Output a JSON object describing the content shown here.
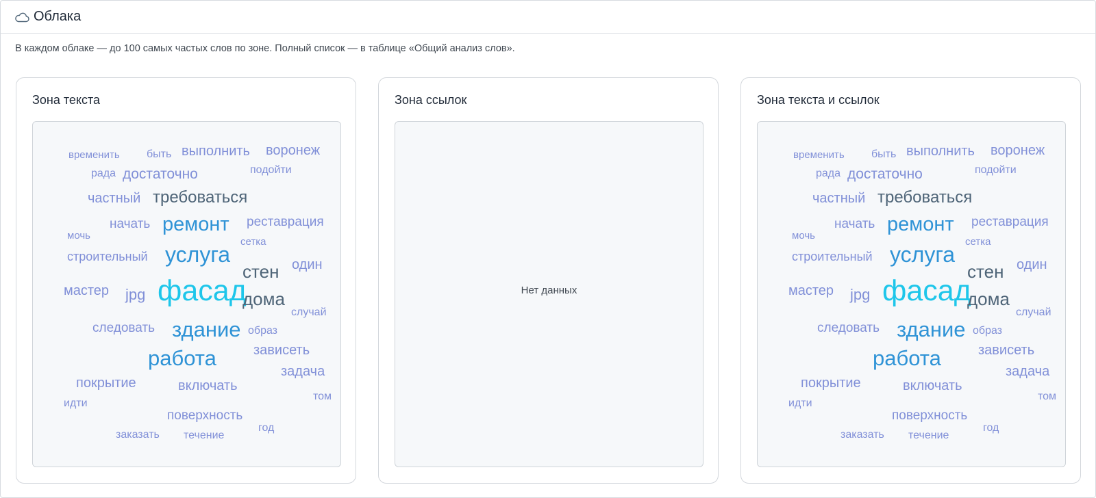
{
  "header": {
    "icon": "cloud-icon",
    "title": "Облака"
  },
  "description": "В каждом облаке — до 100 самых частых слов по зоне. Полный список — в таблице «Общий анализ слов».",
  "colors": {
    "large": "#1ec6ea",
    "medium": "#2f93d6",
    "dark": "#4f6578",
    "light": "#8190d8"
  },
  "cards": [
    {
      "title": "Зона текста",
      "empty": false,
      "words": [
        {
          "text": "временить",
          "tone": "light"
        },
        {
          "text": "быть",
          "tone": "light"
        },
        {
          "text": "выполнить",
          "tone": "light"
        },
        {
          "text": "воронеж",
          "tone": "light"
        },
        {
          "text": "рада",
          "tone": "light"
        },
        {
          "text": "достаточно",
          "tone": "light"
        },
        {
          "text": "подойти",
          "tone": "light"
        },
        {
          "text": "частный",
          "tone": "light"
        },
        {
          "text": "требоваться",
          "tone": "dark"
        },
        {
          "text": "моч‌ь",
          "tone": "light"
        },
        {
          "text": "начать",
          "tone": "light"
        },
        {
          "text": "ремонт",
          "tone": "medium"
        },
        {
          "text": "реставрация",
          "tone": "light"
        },
        {
          "text": "сетка",
          "tone": "light"
        },
        {
          "text": "строительный",
          "tone": "light"
        },
        {
          "text": "услуга",
          "tone": "medium"
        },
        {
          "text": "стен",
          "tone": "dark"
        },
        {
          "text": "один",
          "tone": "light"
        },
        {
          "text": "мастер",
          "tone": "light"
        },
        {
          "text": "jpg",
          "tone": "light"
        },
        {
          "text": "фасад",
          "tone": "large"
        },
        {
          "text": "дома",
          "tone": "dark"
        },
        {
          "text": "случай",
          "tone": "light"
        },
        {
          "text": "следовать",
          "tone": "light"
        },
        {
          "text": "здание",
          "tone": "medium"
        },
        {
          "text": "образ",
          "tone": "light"
        },
        {
          "text": "зависеть",
          "tone": "light"
        },
        {
          "text": "работа",
          "tone": "medium"
        },
        {
          "text": "задача",
          "tone": "light"
        },
        {
          "text": "покрытие",
          "tone": "light"
        },
        {
          "text": "включать",
          "tone": "light"
        },
        {
          "text": "том",
          "tone": "light"
        },
        {
          "text": "идти",
          "tone": "light"
        },
        {
          "text": "поверхность",
          "tone": "light"
        },
        {
          "text": "заказать",
          "tone": "light"
        },
        {
          "text": "течение",
          "tone": "light"
        },
        {
          "text": "год",
          "tone": "light"
        }
      ]
    },
    {
      "title": "Зона ссылок",
      "empty": true,
      "empty_text": "Нет данных"
    },
    {
      "title": "Зона текста и ссылок",
      "empty": false,
      "words": [
        {
          "text": "временить",
          "tone": "light"
        },
        {
          "text": "быть",
          "tone": "light"
        },
        {
          "text": "выполнить",
          "tone": "light"
        },
        {
          "text": "воронеж",
          "tone": "light"
        },
        {
          "text": "рада",
          "tone": "light"
        },
        {
          "text": "достаточно",
          "tone": "light"
        },
        {
          "text": "подойти",
          "tone": "light"
        },
        {
          "text": "частный",
          "tone": "light"
        },
        {
          "text": "требоваться",
          "tone": "dark"
        },
        {
          "text": "моч‌ь",
          "tone": "light"
        },
        {
          "text": "начать",
          "tone": "light"
        },
        {
          "text": "ремонт",
          "tone": "medium"
        },
        {
          "text": "реставрация",
          "tone": "light"
        },
        {
          "text": "сетка",
          "tone": "light"
        },
        {
          "text": "строительный",
          "tone": "light"
        },
        {
          "text": "услуга",
          "tone": "medium"
        },
        {
          "text": "стен",
          "tone": "dark"
        },
        {
          "text": "один",
          "tone": "light"
        },
        {
          "text": "мастер",
          "tone": "light"
        },
        {
          "text": "jpg",
          "tone": "light"
        },
        {
          "text": "фасад",
          "tone": "large"
        },
        {
          "text": "дома",
          "tone": "dark"
        },
        {
          "text": "случай",
          "tone": "light"
        },
        {
          "text": "следовать",
          "tone": "light"
        },
        {
          "text": "здание",
          "tone": "medium"
        },
        {
          "text": "образ",
          "tone": "light"
        },
        {
          "text": "зависеть",
          "tone": "light"
        },
        {
          "text": "работа",
          "tone": "medium"
        },
        {
          "text": "задача",
          "tone": "light"
        },
        {
          "text": "покрытие",
          "tone": "light"
        },
        {
          "text": "включать",
          "tone": "light"
        },
        {
          "text": "том",
          "tone": "light"
        },
        {
          "text": "идти",
          "tone": "light"
        },
        {
          "text": "поверхность",
          "tone": "light"
        },
        {
          "text": "заказать",
          "tone": "light"
        },
        {
          "text": "течение",
          "tone": "light"
        },
        {
          "text": "год",
          "tone": "light"
        }
      ]
    }
  ]
}
